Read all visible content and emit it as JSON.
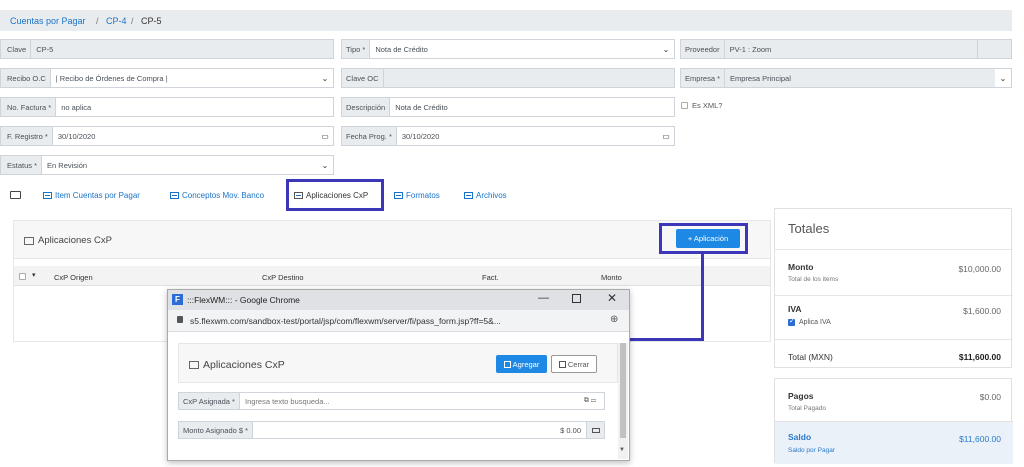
{
  "breadcrumb": {
    "part1": "Cuentas por Pagar",
    "sep1": "/",
    "part2": "CP-4",
    "sep2": "/",
    "part3": "CP-5"
  },
  "form": {
    "clave": {
      "label": "Clave",
      "value": "CP-5"
    },
    "tipo": {
      "label": "Tipo *",
      "value": "Nota de Crédito"
    },
    "proveedor": {
      "label": "Proveedor",
      "value": "PV-1 : Zoom"
    },
    "recibo": {
      "label": "Recibo O.C",
      "value": "| Recibo de Órdenes de Compra |"
    },
    "clave_oc": {
      "label": "Clave OC",
      "value": ""
    },
    "empresa": {
      "label": "Empresa *",
      "value": "Empresa Principal"
    },
    "factura": {
      "label": "No. Factura *",
      "value": "no aplica"
    },
    "descripcion": {
      "label": "Descripción",
      "value": "Nota de Crédito"
    },
    "es_xml": {
      "label": "Es XML?"
    },
    "registro": {
      "label": "F. Registro *",
      "value": "30/10/2020"
    },
    "fecha_prog": {
      "label": "Fecha Prog. *",
      "value": "30/10/2020"
    },
    "estatus": {
      "label": "Estatus *",
      "value": "En Revisión"
    }
  },
  "tabs": {
    "items": "Item Cuentas por Pagar",
    "conceptos": "Conceptos Mov. Banco",
    "aplicaciones": "Aplicaciones CxP",
    "formatos": "Formatos",
    "archivos": "Archivos"
  },
  "aplicaciones_panel": {
    "title": "Aplicaciones CxP",
    "add_button": "+ Aplicación",
    "columns": {
      "origen": "CxP Origen",
      "destino": "CxP Destino",
      "fact": "Fact.",
      "monto": "Monto"
    }
  },
  "totales": {
    "title": "Totales",
    "monto_label": "Monto",
    "monto_sub": "Total de los items",
    "monto_value": "$10,000.00",
    "iva_label": "IVA",
    "iva_check_label": "Aplica IVA",
    "iva_value": "$1,600.00",
    "total_label": "Total (MXN)",
    "total_value": "$11,600.00",
    "pagos_label": "Pagos",
    "pagos_sub": "Total Pagado",
    "pagos_value": "$0.00",
    "saldo_label": "Saldo",
    "saldo_sub": "Saldo por Pagar",
    "saldo_value": "$11,600.00"
  },
  "popup": {
    "window_title": ":::FlexWM::: - Google Chrome",
    "url": "s5.flexwm.com/sandbox-test/portal/jsp/com/flexwm/server/fi/pass_form.jsp?ff=5&...",
    "heading": "Aplicaciones CxP",
    "agregar": "Agregar",
    "cerrar": "Cerrar",
    "cxp_label": "CxP Asignada *",
    "cxp_placeholder": "Ingresa texto busqueda...",
    "monto_label": "Monto Asignado $ *",
    "monto_value": "$ 0.00"
  },
  "colors": {
    "accent": "#1e88e5",
    "highlight": "#3b37b8",
    "link": "#1a73c8"
  }
}
